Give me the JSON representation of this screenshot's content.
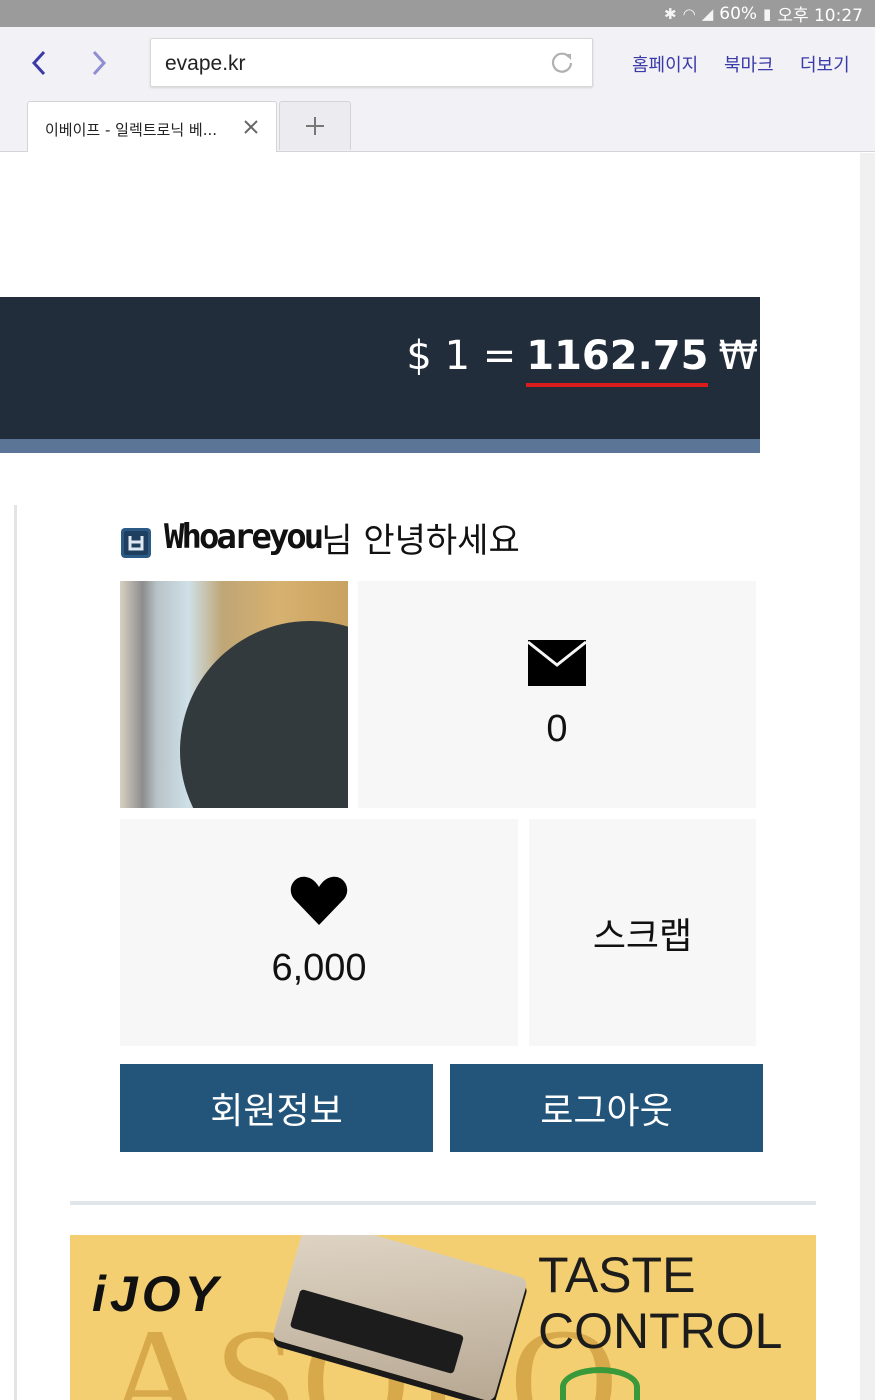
{
  "status_bar": {
    "battery": "60%",
    "time": "오후 10:27"
  },
  "browser": {
    "url": "evape.kr",
    "menu": {
      "home": "홈페이지",
      "bookmarks": "북마크",
      "more": "더보기"
    },
    "tab": {
      "title": "이베이프 - 일렉트로닉 베..."
    },
    "new_tab_label": "+"
  },
  "exchange_rate": {
    "prefix": "$ 1 =",
    "value": "1162.75",
    "currency": "₩"
  },
  "member": {
    "nickname": "Whoareyou",
    "greeting_suffix": "님 안녕하세요",
    "level_badge": "ㅂ",
    "messages_count": "0",
    "likes_count": "6,000",
    "scrap_label": "스크랩",
    "profile_button": "회원정보",
    "logout_button": "로그아웃"
  },
  "ad": {
    "brand": "iJOY",
    "slogan_line1": "TASTE",
    "slogan_line2": "CONTROL",
    "watermark": "ASOLO"
  },
  "icons": {
    "message": "envelope-icon",
    "like": "heart-icon"
  },
  "colors": {
    "banner_bg": "#222d3c",
    "rate_underline": "#d91c1c",
    "button_bg": "#23557a",
    "link": "#3a3aa8"
  }
}
